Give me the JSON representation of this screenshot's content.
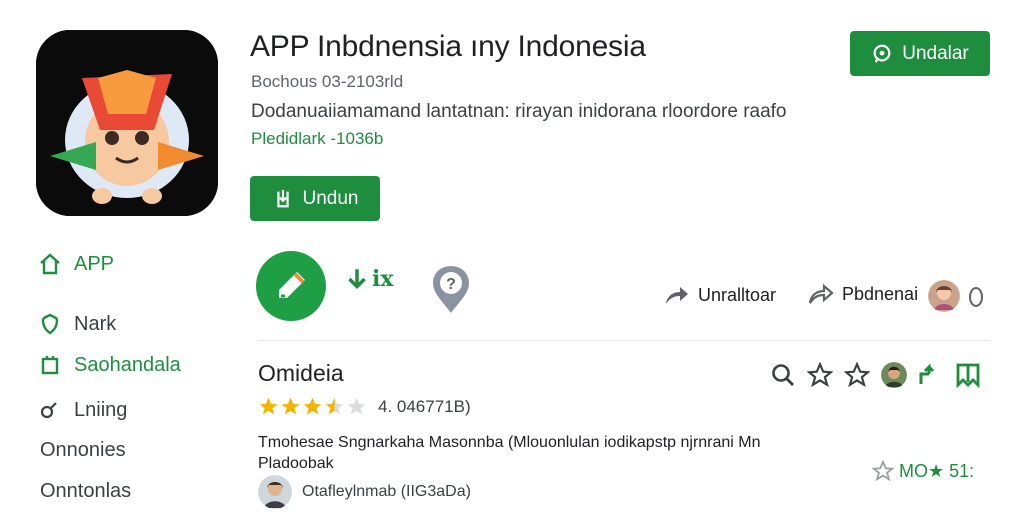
{
  "app": {
    "title": "APP Inbdnensia ıny Indonesia",
    "developer": "Bochous 03-2103rld",
    "description": "Dodanuaiiamamand lantatnan: rirayan inidorana rloordore raafo",
    "tag": "Pledidlark -1036b",
    "top_button_label": "Undalar",
    "install_button_label": "Undun"
  },
  "sidebar": {
    "items": [
      {
        "label": "APP",
        "icon": "home-icon"
      },
      {
        "label": "Nark",
        "icon": "shield-icon"
      },
      {
        "label": "Saohandala",
        "icon": "square-icon"
      },
      {
        "label": "Lniing",
        "icon": "link-icon"
      },
      {
        "label": "Onnonies",
        "icon": ""
      },
      {
        "label": "Onntonlas",
        "icon": ""
      }
    ]
  },
  "actions": {
    "ix_label": "ix",
    "share_label": "Unralltoar",
    "forward_label": "Pbdnenai",
    "info_label": "0"
  },
  "review": {
    "title": "Omideia",
    "rating": 3.5,
    "rating_text": "4. 046771B)",
    "body": "Tmohesae Sngnarkaha Masonnba (Mlouonlulan iodikapstp njrnrani Mn Pladoobak",
    "author": "Otafleylnmab (IIG3aDa)",
    "count_text": "MO★ 51:"
  },
  "colors": {
    "accent": "#1e8e3e",
    "star": "#f4b400",
    "text": "#202124"
  }
}
